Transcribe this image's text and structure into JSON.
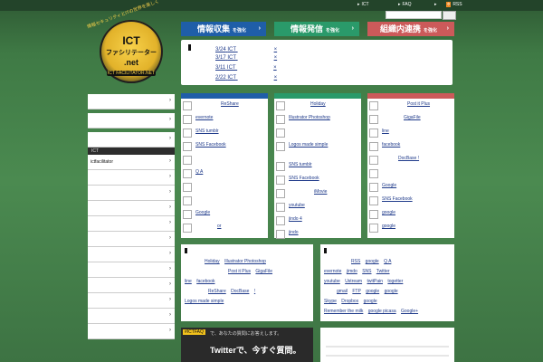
{
  "topbar": {
    "nav": [
      "ICT",
      "FAQ",
      "RSS"
    ],
    "search": {
      "placeholder": ""
    }
  },
  "logo": {
    "line1": "ICT",
    "line2": "ファシリテーター",
    "line3": ".net",
    "line4": "ICT FACILITATOR.NET",
    "arc_text": "情報セキュリティとITの世界を楽しく"
  },
  "tabs": [
    {
      "label_big": "情報収集",
      "label_small": "を強化"
    },
    {
      "label_big": "情報発信",
      "label_small": "を強化"
    },
    {
      "label_big": "組織内連携",
      "label_small": "を強化"
    }
  ],
  "news": [
    {
      "date": "3/24",
      "title": "ICT",
      "suffix": "×"
    },
    {
      "date": "3/17",
      "title": "ICT",
      "suffix": "×"
    },
    {
      "date": "3/11",
      "title": "ICT",
      "suffix": "×"
    },
    {
      "date": "2/22",
      "title": "ICT",
      "suffix": "×"
    }
  ],
  "sidebar": {
    "section_head": "ICT",
    "link_text": "ictfacilitator"
  },
  "panel1": [
    "ReShare",
    "evernote",
    "SNS tumblr",
    "SNS Facebook",
    "",
    "Q A",
    "",
    "",
    "Google",
    "or"
  ],
  "panel2": [
    "Holiday",
    "Illustrator Photoshop",
    "",
    "Logos made simple",
    "SNS tumblr",
    "SNS Facebook",
    "iMovie",
    "youtube",
    "jindo 4",
    "jindo"
  ],
  "panel3": [
    "Post it Plus",
    "GigaFile",
    "line",
    "facebook",
    "DocBase !",
    "",
    "Google",
    "SNS Facebook",
    "google",
    "google"
  ],
  "tags_left": [
    "Holiday",
    "Illustrator Photoshop",
    "Post it Plus",
    "GigaFile",
    "line",
    "facebook",
    "ReShare",
    "DocBase",
    "!",
    "Logos made simple"
  ],
  "tags_right": [
    "RSS",
    "google",
    "Q A",
    "evernote",
    "jimdo",
    "SNS",
    "Twitter",
    "youtube",
    "Ustream",
    "twitPain",
    "togetter",
    "gmail",
    "FTP",
    "google",
    "google",
    "Skype",
    "Dropbox",
    "google",
    "Remember the milk",
    "google picasa",
    "Google+"
  ],
  "twitter": {
    "tag": "#ICTFAQ",
    "desc": "で、あなたの質問にお答えします。",
    "title": "Twitterで、今すぐ質問。"
  },
  "colors": {
    "blue": "#1f5ea8",
    "green": "#2a9a6a",
    "red": "#cc5a5a"
  }
}
